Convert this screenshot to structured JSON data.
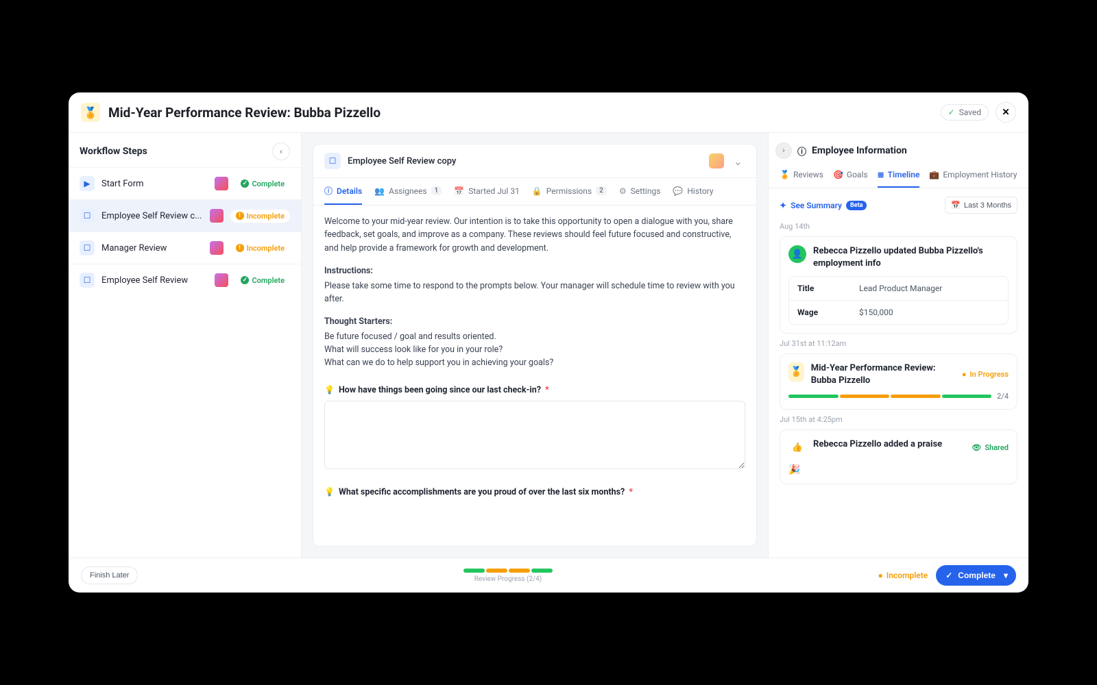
{
  "header": {
    "title": "Mid-Year Performance Review: Bubba Pizzello",
    "saved_label": "Saved"
  },
  "sidebar": {
    "title": "Workflow Steps",
    "steps": [
      {
        "icon": "play",
        "label": "Start Form",
        "status": "Complete",
        "status_kind": "complete",
        "active": false
      },
      {
        "icon": "box",
        "label": "Employee Self Review c...",
        "status": "Incomplete",
        "status_kind": "incomplete",
        "active": true
      },
      {
        "icon": "box",
        "label": "Manager Review",
        "status": "Incomplete",
        "status_kind": "incomplete",
        "active": false
      },
      {
        "icon": "box",
        "label": "Employee Self Review",
        "status": "Complete",
        "status_kind": "complete",
        "active": false
      }
    ]
  },
  "center": {
    "panel_title": "Employee Self Review copy",
    "tabs": [
      {
        "icon": "ℹ",
        "label": "Details",
        "count": null,
        "active": true
      },
      {
        "icon": "👥",
        "label": "Assignees",
        "count": "1",
        "active": false
      },
      {
        "icon": "📅",
        "label": "Started Jul 31",
        "count": null,
        "active": false
      },
      {
        "icon": "🔒",
        "label": "Permissions",
        "count": "2",
        "active": false
      },
      {
        "icon": "⚙",
        "label": "Settings",
        "count": null,
        "active": false
      },
      {
        "icon": "💬",
        "label": "History",
        "count": null,
        "active": false
      }
    ],
    "intro": "Welcome to your mid-year review. Our intention is to take this opportunity to open a dialogue with you, share feedback, set goals, and improve as a company. These reviews should feel future focused and constructive, and help provide a framework for growth and development.",
    "instructions_label": "Instructions:",
    "instructions_body": "Please take some time to respond to the prompts below. Your manager will schedule time to review with you after.",
    "starters_label": "Thought Starters:",
    "starters_1": "Be future focused / goal and results oriented.",
    "starters_2": "What will success look like for you in your role?",
    "starters_3": "What can we do to help support you in achieving your goals?",
    "q1": "How have things been going since our last check-in?",
    "q2": "What specific accomplishments are you proud of over the last six months?"
  },
  "right": {
    "title": "Employee Information",
    "tabs": [
      {
        "icon": "🏅",
        "label": "Reviews",
        "active": false
      },
      {
        "icon": "🎯",
        "label": "Goals",
        "active": false
      },
      {
        "icon": "≣",
        "label": "Timeline",
        "active": true
      },
      {
        "icon": "💼",
        "label": "Employment History",
        "active": false
      }
    ],
    "summary_label": "See Summary",
    "summary_badge": "Beta",
    "range_label": "Last 3 Months",
    "timeline": {
      "d1": "Aug 14th",
      "e1_title": "Rebecca Pizzello updated Bubba Pizzello's employment info",
      "e1_k1": "Title",
      "e1_v1": "Lead Product Manager",
      "e1_k2": "Wage",
      "e1_v2": "$150,000",
      "d2": "Jul 31st at 11:12am",
      "e2_title": "Mid-Year Performance Review: Bubba Pizzello",
      "e2_status": "In Progress",
      "e2_frac": "2/4",
      "d3": "Jul 15th at 4:25pm",
      "e3_title": "Rebecca Pizzello added a praise",
      "e3_shared": "Shared"
    }
  },
  "footer": {
    "finish_later": "Finish Later",
    "progress_text": "Review Progress (2/4)",
    "incomplete": "Incomplete",
    "complete": "Complete"
  }
}
